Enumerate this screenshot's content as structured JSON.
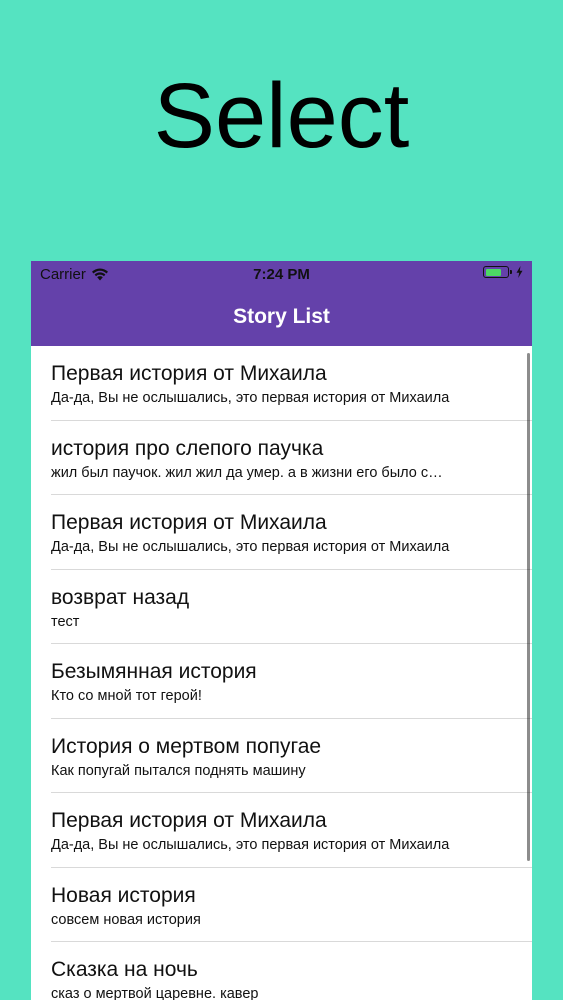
{
  "headline": "Select",
  "status_bar": {
    "carrier": "Carrier",
    "time": "7:24 PM",
    "battery_percent": 75,
    "battery_color": "#4cd964",
    "wifi_icon": "wifi-icon",
    "charging_icon": "bolt-icon"
  },
  "nav": {
    "title": "Story List",
    "color": "#6441aa"
  },
  "stories": [
    {
      "title": "Первая история от Михаила",
      "subtitle": "Да-да, Вы не ослышались, это первая история от Михаила"
    },
    {
      "title": "история про слепого паучка",
      "subtitle": "жил был паучок. жил жил да умер. а в жизни его было с…"
    },
    {
      "title": "Первая история от Михаила",
      "subtitle": "Да-да, Вы не ослышались, это первая история от Михаила"
    },
    {
      "title": "возврат назад",
      "subtitle": "тест"
    },
    {
      "title": "Безымянная история",
      "subtitle": "Кто со мной тот герой!"
    },
    {
      "title": "История о мертвом попугае",
      "subtitle": "Как попугай пытался поднять машину"
    },
    {
      "title": "Первая история от Михаила",
      "subtitle": "Да-да, Вы не ослышались, это первая история от Михаила"
    },
    {
      "title": "Новая история",
      "subtitle": "совсем новая история"
    },
    {
      "title": "Сказка на ночь",
      "subtitle": "сказ о мертвой царевне. кавер"
    }
  ]
}
